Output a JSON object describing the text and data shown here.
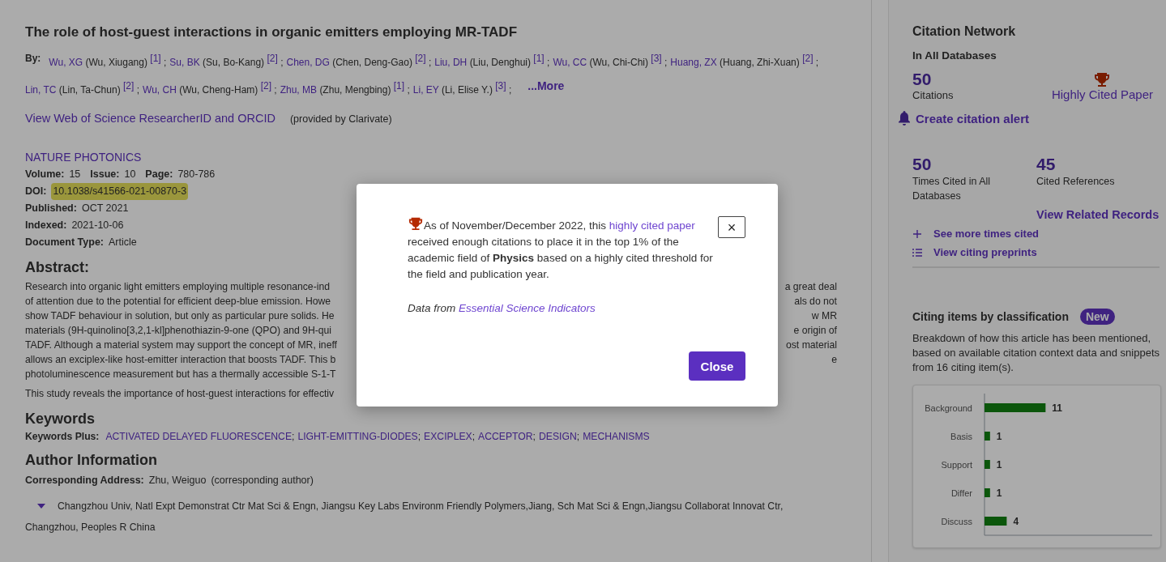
{
  "record": {
    "title": "The role of host-guest interactions in organic emitters employing MR-TADF",
    "by_label": "By:",
    "authors": [
      {
        "short": "Wu, XG",
        "full": "(Wu, Xiugang)",
        "affiliation": "[1]",
        "separator": ";"
      },
      {
        "short": "Su, BK",
        "full": "(Su, Bo-Kang)",
        "affiliation": "[2]",
        "separator": ";"
      },
      {
        "short": "Chen, DG",
        "full": "(Chen, Deng-Gao)",
        "affiliation": "[2]",
        "separator": ";"
      },
      {
        "short": "Liu, DH",
        "full": "(Liu, Denghui)",
        "affiliation": "[1]",
        "separator": ";"
      },
      {
        "short": "Wu, CC",
        "full": "(Wu, Chi-Chi)",
        "affiliation": "[3]",
        "separator": ";"
      },
      {
        "short": "Huang, ZX",
        "full": "(Huang, Zhi-Xuan)",
        "affiliation": "[2]",
        "separator": ";"
      },
      {
        "short": "Lin, TC",
        "full": "(Lin, Ta-Chun)",
        "affiliation": "[2]",
        "separator": ";"
      },
      {
        "short": "Wu, CH",
        "full": "(Wu, Cheng-Ham)",
        "affiliation": "[2]",
        "separator": ";"
      },
      {
        "short": "Zhu, MB",
        "full": "(Zhu, Mengbing)",
        "affiliation": "[1]",
        "separator": ";"
      },
      {
        "short": "Li, EY",
        "full": "(Li, Elise Y.)",
        "affiliation": "[3]",
        "separator": ";"
      }
    ],
    "more_link": "...More",
    "researcher_link": "View Web of Science ResearcherID and ORCID",
    "provided_by": "(provided by Clarivate)",
    "journal": "NATURE PHOTONICS",
    "volume_label": "Volume:",
    "volume": "15",
    "issue_label": "Issue:",
    "issue": "10",
    "page_label": "Page:",
    "page": "780-786",
    "doi_label": "DOI:",
    "doi": "10.1038/s41566-021-00870-3",
    "doi_highlighted": true,
    "fields": [
      {
        "label": "Published:",
        "value": "OCT 2021"
      },
      {
        "label": "Indexed:",
        "value": "2021-10-06"
      },
      {
        "label": "Document Type:",
        "value": "Article"
      }
    ],
    "abstract_heading": "Abstract:",
    "abstract_lines": [
      {
        "left": "Research into organic light emitters employing multiple resonance-ind",
        "right": "a great deal"
      },
      {
        "left": "of attention due to the potential for efficient deep-blue emission. Howe",
        "right": "als do not"
      },
      {
        "left": "show TADF behaviour in solution, but only as particular pure solids. He",
        "right": "w MR"
      },
      {
        "left": "materials (9H-quinolino[3,2,1-kl]phenothiazin-9-one (QPO) and 9H-qui",
        "right": "e origin of"
      },
      {
        "left": "TADF. Although a material system may support the concept of MR, ineff",
        "right": "ost material"
      },
      {
        "left": "allows an exciplex-like host-emitter interaction that boosts TADF. This b",
        "right": "e"
      },
      {
        "left": "photoluminescence measurement but has a thermally accessible S-1-T"
      }
    ],
    "abstract_tail": "This study reveals the importance of host-guest interactions for effectiv",
    "keywords_heading": "Keywords",
    "keywords_label": "Keywords Plus:",
    "keywords": [
      {
        "text": "ACTIVATED DELAYED FLUORESCENCE",
        "separator": ";"
      },
      {
        "text": "LIGHT-EMITTING-DIODES",
        "separator": ";"
      },
      {
        "text": "EXCIPLEX",
        "separator": ";"
      },
      {
        "text": "ACCEPTOR",
        "separator": ";"
      },
      {
        "text": "DESIGN",
        "separator": ";"
      },
      {
        "text": "MECHANISMS"
      }
    ],
    "author_info_heading": "Author Information",
    "corresponding_label": "Corresponding Address:",
    "corresponding_name": "Zhu, Weiguo",
    "corresponding_note": "(corresponding author)",
    "address_expanded": true,
    "address_line1": "Changzhou Univ, Natl Expt Demonstrat Ctr Mat Sci & Engn, Jiangsu Key Labs Environm Friendly Polymers,Jiang, Sch Mat Sci & Engn,Jiangsu Collaborat Innovat Ctr,",
    "address_line2": "Changzhou, Peoples R China"
  },
  "sidebar": {
    "title": "Citation Network",
    "subtitle": "In All Databases",
    "citations": "50",
    "citations_label": "Citations",
    "highly_cited": "Highly Cited Paper",
    "alert": "Create citation alert",
    "stats": [
      {
        "value": "50",
        "label": "Times Cited in All Databases"
      },
      {
        "value": "45",
        "label": "Cited References"
      }
    ],
    "related": "View Related Records",
    "links": [
      {
        "kind": "plus",
        "text": "See more times cited"
      },
      {
        "kind": "list",
        "text": "View citing preprints"
      }
    ],
    "classification_title": "Citing items by classification",
    "badge": "New",
    "classification_text": "Breakdown of how this article has been mentioned, based on available citation context data and snippets from 16 citing item(s).",
    "chart_data": {
      "type": "bar",
      "orientation": "horizontal",
      "categories": [
        "Background",
        "Basis",
        "Support",
        "Differ",
        "Discuss"
      ],
      "series": [
        {
          "color": "#118011",
          "values": [
            11,
            1,
            1,
            1,
            4
          ]
        }
      ],
      "data_labels": true
    }
  },
  "modal": {
    "text_before": "As of November/December 2022, this ",
    "link": "highly cited paper",
    "text_after": " received enough citations to place it in the top 1% of the academic field of **Physics** based on a highly cited threshold for the field and publication year.",
    "source_prefix": "Data from ",
    "source_link": "Essential Science Indicators",
    "close_x": "×",
    "close_button": "Close"
  }
}
